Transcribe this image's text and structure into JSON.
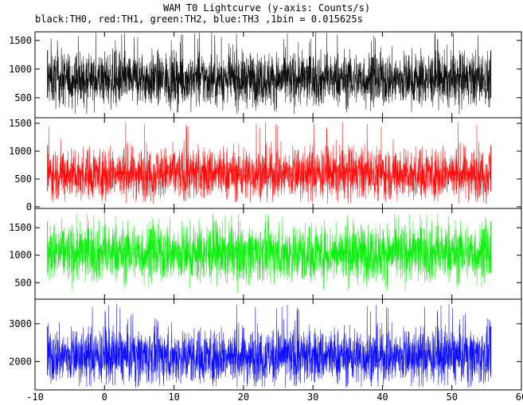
{
  "chart_data": {
    "type": "line",
    "title": "WAM T0 Lightcurve (y-axis: Counts/s)",
    "subtitle": "black:TH0, red:TH1, green:TH2, blue:TH3 ,1bin = 0.015625s",
    "x_ticks": [
      -10,
      0,
      10,
      20,
      30,
      40,
      50,
      60
    ],
    "xlim": [
      -10,
      60
    ],
    "data_x_range": [
      -8.2,
      55.6
    ],
    "bin_size_s": 0.015625,
    "series": [
      {
        "name": "TH0",
        "color": "#000000",
        "ylim": [
          150,
          1650
        ],
        "yticks": [
          500,
          1000,
          1500
        ],
        "mean": 820,
        "noise": 230,
        "spike_max": 1650,
        "low_min": 200
      },
      {
        "name": "TH1",
        "color": "#ff0000",
        "ylim": [
          -30,
          1600
        ],
        "yticks": [
          0,
          500,
          1000,
          1500
        ],
        "mean": 600,
        "noise": 230,
        "spike_max": 1560,
        "low_min": 50
      },
      {
        "name": "TH2",
        "color": "#00ee00",
        "ylim": [
          200,
          1850
        ],
        "yticks": [
          500,
          1000,
          1500
        ],
        "mean": 1040,
        "noise": 260,
        "spike_max": 1750,
        "low_min": 300
      },
      {
        "name": "TH3",
        "color": "#0000ff",
        "ylim": [
          1250,
          3650
        ],
        "yticks": [
          2000,
          3000
        ],
        "mean": 2140,
        "noise": 360,
        "spike_max": 3550,
        "low_min": 1300
      }
    ]
  }
}
